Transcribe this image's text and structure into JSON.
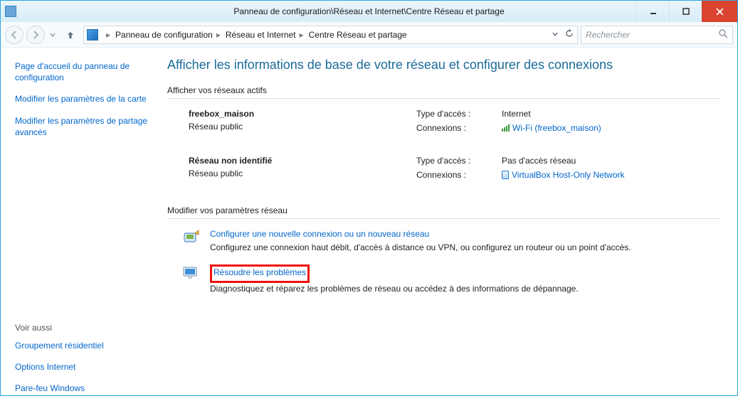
{
  "window": {
    "title": "Panneau de configuration\\Réseau et Internet\\Centre Réseau et partage"
  },
  "breadcrumb": {
    "segments": [
      "Panneau de configuration",
      "Réseau et Internet",
      "Centre Réseau et partage"
    ]
  },
  "search": {
    "placeholder": "Rechercher"
  },
  "sidebar": {
    "items": [
      "Page d'accueil du panneau de configuration",
      "Modifier les paramètres de la carte",
      "Modifier les paramètres de partage avancés"
    ],
    "seealso_label": "Voir aussi",
    "seealso": [
      "Groupement résidentiel",
      "Options Internet",
      "Pare-feu Windows"
    ]
  },
  "main": {
    "heading": "Afficher les informations de base de votre réseau et configurer des connexions",
    "active_label": "Afficher vos réseaux actifs",
    "networks": [
      {
        "name": "freebox_maison",
        "type": "Réseau public",
        "access_label": "Type d'accès :",
        "access_value": "Internet",
        "conn_label": "Connexions :",
        "conn_link": "Wi-Fi (freebox_maison)",
        "conn_kind": "wifi"
      },
      {
        "name": "Réseau non identifié",
        "type": "Réseau public",
        "access_label": "Type d'accès :",
        "access_value": "Pas d'accès réseau",
        "conn_label": "Connexions :",
        "conn_link": "VirtualBox Host-Only Network",
        "conn_kind": "eth"
      }
    ],
    "settings_label": "Modifier vos paramètres réseau",
    "settings": [
      {
        "link": "Configurer une nouvelle connexion ou un nouveau réseau",
        "desc": "Configurez une connexion haut débit, d'accès à distance ou VPN, ou configurez un routeur ou un point d'accès."
      },
      {
        "link": "Résoudre les problèmes",
        "desc": "Diagnostiquez et réparez les problèmes de réseau ou accédez à des informations de dépannage."
      }
    ]
  }
}
